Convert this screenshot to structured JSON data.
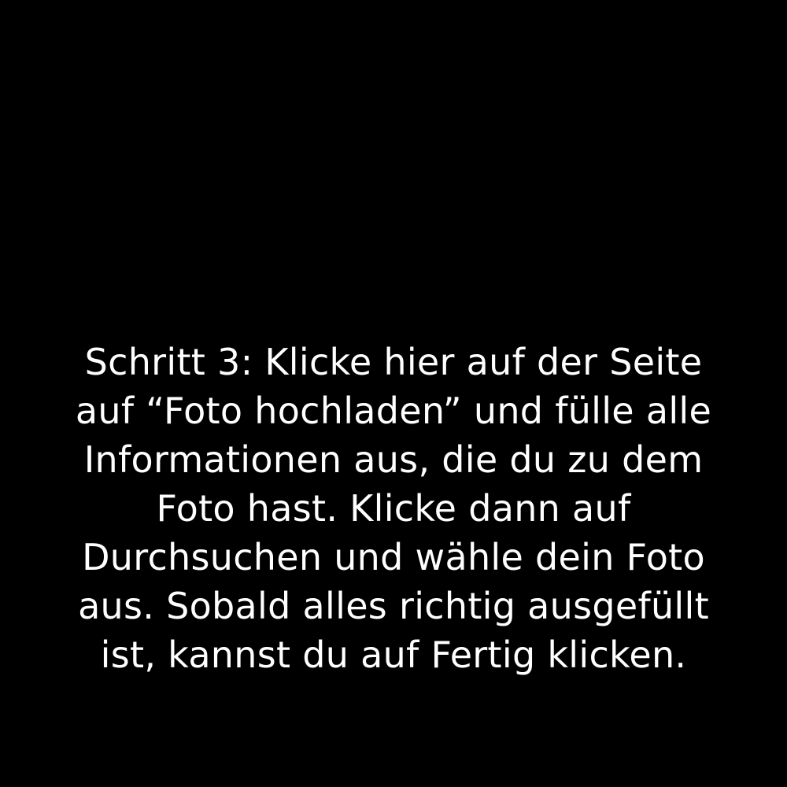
{
  "colors": {
    "background": "#000000",
    "text": "#ffffff"
  },
  "caption": {
    "lines": [
      "Schritt 3: Klicke hier auf der Seite",
      "auf “Foto hochladen” und fülle alle",
      "Informationen aus, die du zu dem",
      "Foto hast. Klicke dann auf",
      "Durchsuchen und wähle dein Foto",
      "aus. Sobald alles richtig ausgefüllt",
      "ist, kannst du auf Fertig klicken."
    ]
  }
}
